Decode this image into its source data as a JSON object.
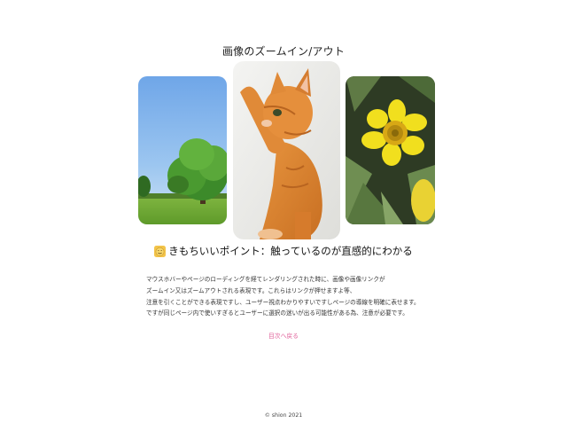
{
  "page": {
    "title": "画像のズームイン/アウト"
  },
  "gallery": {
    "images": [
      {
        "name": "tree",
        "alt_icon": "tree-photo"
      },
      {
        "name": "cat",
        "alt_icon": "cat-photo"
      },
      {
        "name": "flower",
        "alt_icon": "flower-photo"
      }
    ]
  },
  "section": {
    "emoji_icon": "smiley-face-icon",
    "heading": "きもちいいポイント：触っているのが直感的にわかる",
    "lines": [
      "マウスホバーやページのローディングを経てレンダリングされた時に、画像や画像リンクが",
      "ズームイン又はズームアウトされる表現です。これらはリンクが押せますよ等、",
      "注意を引くことができる表現ですし、ユーザー視点わかりやすいですしページの導線を明確に表せます。",
      "ですが同じページ内で使いすぎるとユーザーに選択の迷いが出る可能性がある為、注意が必要です。"
    ]
  },
  "nav": {
    "back_label": "目次へ戻る"
  },
  "footer": {
    "copyright": "© shion 2021"
  },
  "colors": {
    "link": "#e0609a",
    "background": "#ffffff"
  }
}
